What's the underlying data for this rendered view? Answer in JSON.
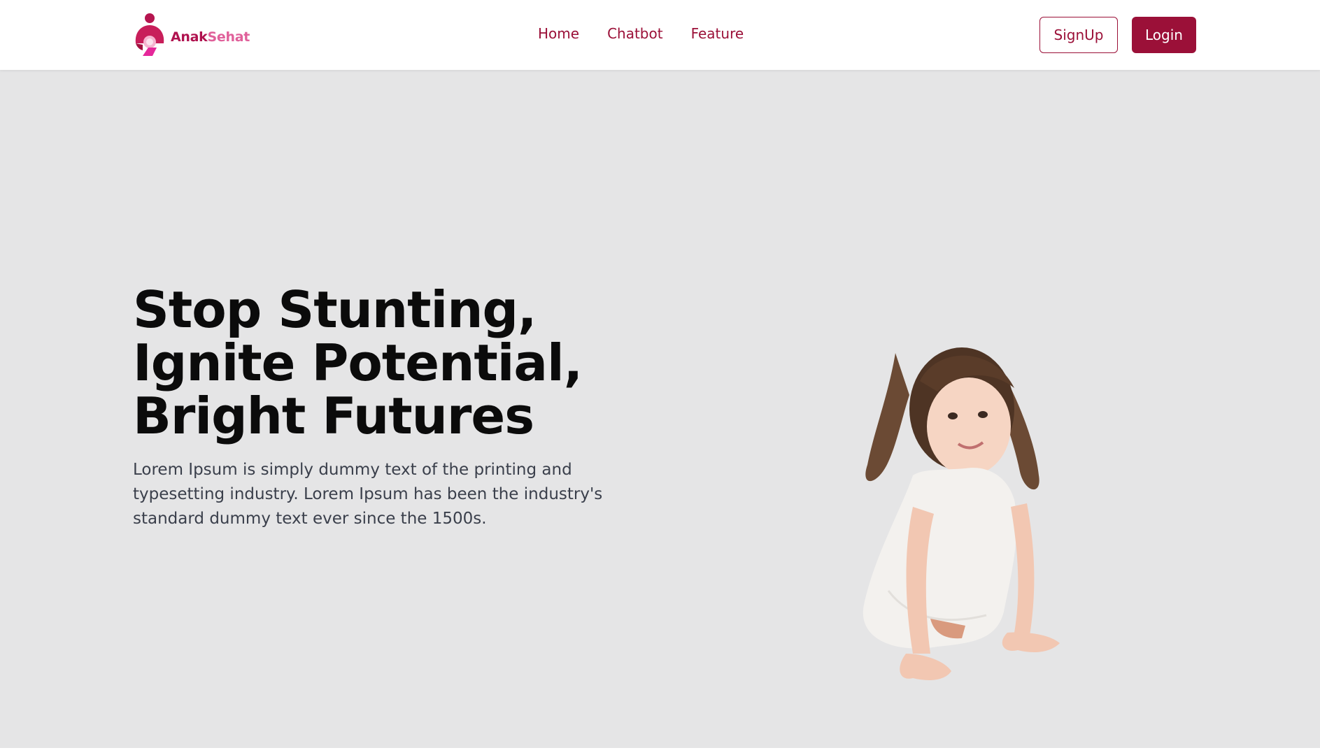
{
  "brand": {
    "name_part1": "Anak",
    "name_part2": "Sehat",
    "logo_icon": "mother-child-icon",
    "colors": {
      "primary": "#9b1038",
      "secondary": "#e0609a"
    }
  },
  "nav": {
    "links": [
      {
        "label": "Home"
      },
      {
        "label": "Chatbot"
      },
      {
        "label": "Feature"
      }
    ]
  },
  "auth": {
    "signup_label": "SignUp",
    "login_label": "Login"
  },
  "hero": {
    "title_lines": [
      "Stop Stunting,",
      "Ignite Potential,",
      "Bright Futures"
    ],
    "description": "Lorem Ipsum is simply dummy text of the printing and typesetting industry. Lorem Ipsum has been the industry's standard dummy text ever since the 1500s.",
    "background": "#e5e5e6",
    "image_subject": "crawling-child-illustration"
  }
}
